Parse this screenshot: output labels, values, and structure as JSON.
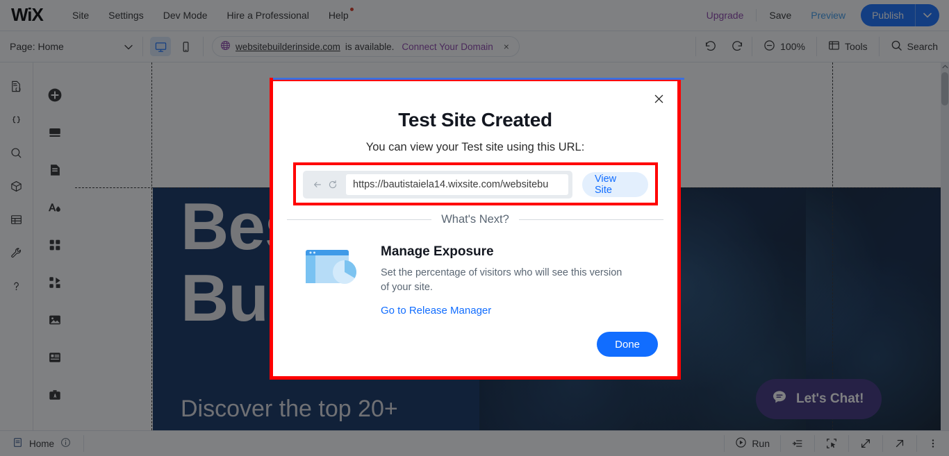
{
  "topbar": {
    "logo": "WiX",
    "nav": [
      {
        "label": "Site",
        "badge": false
      },
      {
        "label": "Settings",
        "badge": false
      },
      {
        "label": "Dev Mode",
        "badge": false
      },
      {
        "label": "Hire a Professional",
        "badge": false
      },
      {
        "label": "Help",
        "badge": true
      }
    ],
    "upgrade": "Upgrade",
    "save": "Save",
    "preview": "Preview",
    "publish": "Publish",
    "publish_caret": "chevron-down-icon",
    "accent_blue": "#116dff",
    "upgrade_color": "#8b3fa8"
  },
  "toolbar2": {
    "page_label": "Page: Home",
    "desktop_icon": "desktop-monitor-icon",
    "mobile_icon": "mobile-phone-icon",
    "domain": {
      "globe_icon": "globe-icon",
      "name": "websitebuilderinside.com",
      "status": "is available.",
      "cta": "Connect Your Domain",
      "close": "×"
    },
    "undo_icon": "undo-arrow-icon",
    "redo_icon": "redo-arrow-icon",
    "zoom_label": "100%",
    "tools_label": "Tools",
    "search_label": "Search"
  },
  "left_rail_dev": [
    {
      "name": "code-file-icon"
    },
    {
      "name": "curly-braces-icon"
    },
    {
      "name": "search-icon"
    },
    {
      "name": "package-cube-icon"
    },
    {
      "name": "database-table-icon"
    },
    {
      "name": "wrench-tools-icon"
    },
    {
      "name": "help-question-icon"
    }
  ],
  "left_rail_add": [
    {
      "name": "add-plus-icon"
    },
    {
      "name": "add-section-icon"
    },
    {
      "name": "add-page-icon"
    },
    {
      "name": "theme-text-color-icon"
    },
    {
      "name": "add-elements-grid-icon"
    },
    {
      "name": "add-apps-puzzle-icon"
    },
    {
      "name": "media-image-icon"
    },
    {
      "name": "content-manager-icon"
    },
    {
      "name": "business-toolkit-icon"
    }
  ],
  "canvas": {
    "hero_heading": "Best Website Builders",
    "hero_sub": "Discover the top 20+",
    "hero_bg": "#0d2d5e",
    "chat": {
      "label": "Let's Chat!",
      "icon": "chat-bubble-icon",
      "color": "#3b2d7a"
    }
  },
  "bottombar": {
    "page_icon": "page-icon",
    "page_label": "Home",
    "info_icon": "info-circle-icon",
    "run_label": "Run",
    "run_icon": "play-circle-icon",
    "layers_icon": "layers-list-icon",
    "select_icon": "select-cursor-icon",
    "expand_icon": "expand-diagonal-icon",
    "popout_icon": "open-external-icon",
    "more_icon": "more-vertical-icon"
  },
  "modal": {
    "close_icon": "close-x-icon",
    "title": "Test Site Created",
    "subtitle": "You can view your Test site using this URL:",
    "url_value": "https://bautistaiela14.wixsite.com/websitebu",
    "back_icon": "back-arrow-icon",
    "reload_icon": "reload-icon",
    "view_site_label": "View Site",
    "whats_next": "What's Next?",
    "card": {
      "icon": "browser-pie-chart-icon",
      "title": "Manage Exposure",
      "description": "Set the percentage of visitors who will see this version of your site.",
      "link": "Go to Release Manager"
    },
    "done_label": "Done",
    "highlight_color": "#ff0000",
    "primary_color": "#116dff"
  }
}
